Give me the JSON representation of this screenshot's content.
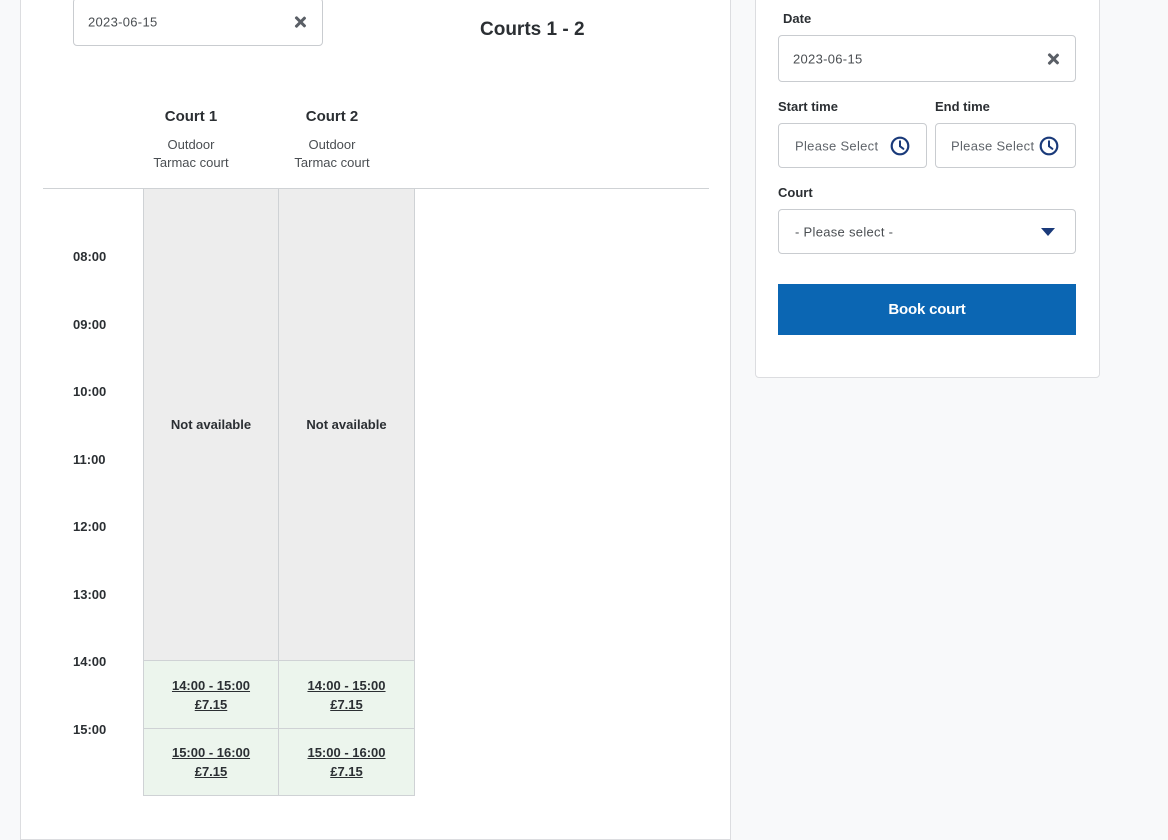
{
  "main": {
    "date_value": "2023-06-15",
    "heading": "Courts 1 - 2",
    "courts": [
      {
        "name": "Court 1",
        "line1": "Outdoor",
        "line2": "Tarmac court"
      },
      {
        "name": "Court 2",
        "line1": "Outdoor",
        "line2": "Tarmac court"
      }
    ],
    "times": [
      "08:00",
      "09:00",
      "10:00",
      "11:00",
      "12:00",
      "13:00",
      "14:00",
      "15:00"
    ],
    "unavailable_label": "Not available",
    "slots": [
      {
        "time": "14:00 - 15:00",
        "price": "£7.15"
      },
      {
        "time": "15:00 - 16:00",
        "price": "£7.15"
      }
    ]
  },
  "sidebar": {
    "date_label": "Date",
    "date_value": "2023-06-15",
    "start_label": "Start time",
    "start_placeholder": "Please Select",
    "end_label": "End time",
    "end_placeholder": "Please Select",
    "court_label": "Court",
    "court_selected": "- Please select -",
    "book_button": "Book court"
  },
  "colors": {
    "accent": "#0b66b3",
    "slot_bg": "#ecf5ed",
    "unavailable_bg": "#ededed",
    "clock_icon": "#1a3a7a"
  }
}
